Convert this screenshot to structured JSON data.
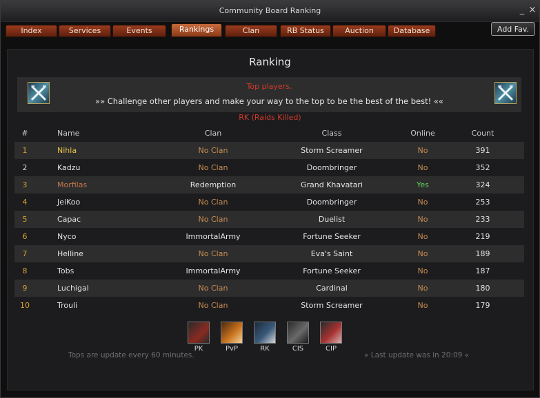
{
  "window": {
    "title": "Community Board Ranking",
    "minimize_glyph": "_",
    "close_glyph": "×"
  },
  "tabs": [
    {
      "label": "Index"
    },
    {
      "label": "Services"
    },
    {
      "label": "Events"
    },
    {
      "label": "Rankings",
      "active": true
    },
    {
      "label": "Clan"
    },
    {
      "label": "RB Status"
    },
    {
      "label": "Auction"
    },
    {
      "label": "Database"
    }
  ],
  "add_fav_label": "Add Fav.",
  "page": {
    "heading": "Ranking",
    "top_title": "Top players.",
    "subtitle": "»» Challenge other players and make your way to the top to be the best of the best! ««",
    "category": "RK (Raids Killed)",
    "banner_icon": "crossed-swords-icon"
  },
  "table": {
    "headers": {
      "rank": "#",
      "name": "Name",
      "clan": "Clan",
      "class": "Class",
      "online": "Online",
      "count": "Count"
    },
    "rows": [
      {
        "rank": "1",
        "name": "Nihla",
        "clan": "No Clan",
        "class": "Storm Screamer",
        "online": "No",
        "count": "391"
      },
      {
        "rank": "2",
        "name": "Kadzu",
        "clan": "No Clan",
        "class": "Doombringer",
        "online": "No",
        "count": "352"
      },
      {
        "rank": "3",
        "name": "Morfilas",
        "clan": "Redemption",
        "class": "Grand Khavatari",
        "online": "Yes",
        "count": "324"
      },
      {
        "rank": "4",
        "name": "JeiKoo",
        "clan": "No Clan",
        "class": "Doombringer",
        "online": "No",
        "count": "253"
      },
      {
        "rank": "5",
        "name": "Capac",
        "clan": "No Clan",
        "class": "Duelist",
        "online": "No",
        "count": "233"
      },
      {
        "rank": "6",
        "name": "Nyco",
        "clan": "ImmortalArmy",
        "class": "Fortune Seeker",
        "online": "No",
        "count": "219"
      },
      {
        "rank": "7",
        "name": "Helline",
        "clan": "No Clan",
        "class": "Eva's Saint",
        "online": "No",
        "count": "189"
      },
      {
        "rank": "8",
        "name": "Tobs",
        "clan": "ImmortalArmy",
        "class": "Fortune Seeker",
        "online": "No",
        "count": "187"
      },
      {
        "rank": "9",
        "name": "Luchigal",
        "clan": "No Clan",
        "class": "Cardinal",
        "online": "No",
        "count": "180"
      },
      {
        "rank": "10",
        "name": "Trouli",
        "clan": "No Clan",
        "class": "Storm Screamer",
        "online": "No",
        "count": "179"
      }
    ]
  },
  "categories": [
    {
      "label": "PK",
      "icon": "pk-icon",
      "color": "#8a2a22"
    },
    {
      "label": "PvP",
      "icon": "pvp-icon",
      "color": "#c8721e"
    },
    {
      "label": "RK",
      "icon": "rk-icon",
      "color": "#3a5a7a"
    },
    {
      "label": "CIS",
      "icon": "cis-icon",
      "color": "#6a6a6a"
    },
    {
      "label": "CIP",
      "icon": "cip-icon",
      "color": "#a83232"
    }
  ],
  "footer": {
    "left": "Tops are update every 60 minutes.",
    "right": "» Last update was in 20:09 «"
  }
}
